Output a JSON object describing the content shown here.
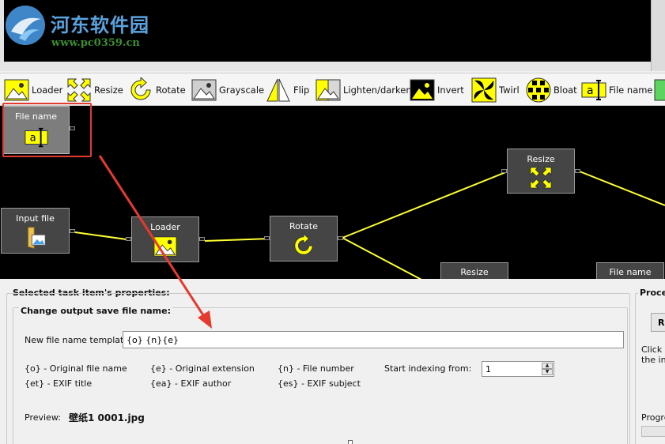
{
  "watermark": {
    "title": "河东软件园",
    "url": "www.pc0359.cn"
  },
  "toolbar": {
    "items": [
      {
        "label": "Loader",
        "icon": "loader-icon"
      },
      {
        "label": "Resize",
        "icon": "resize-icon"
      },
      {
        "label": "Rotate",
        "icon": "rotate-icon"
      },
      {
        "label": "Grayscale",
        "icon": "grayscale-icon"
      },
      {
        "label": "Flip",
        "icon": "flip-icon"
      },
      {
        "label": "Lighten/darken",
        "icon": "lighten-darken-icon"
      },
      {
        "label": "Invert",
        "icon": "invert-icon"
      },
      {
        "label": "Twirl",
        "icon": "twirl-icon"
      },
      {
        "label": "Bloat",
        "icon": "bloat-icon"
      },
      {
        "label": "File name",
        "icon": "file-name-icon"
      }
    ]
  },
  "canvas": {
    "nodes": {
      "file_name": "File name",
      "input_file": "Input file",
      "loader": "Loader",
      "rotate": "Rotate",
      "resize_top": "Resize",
      "resize_bottom": "Resize",
      "file_name_bottom": "File name"
    },
    "wire_color": "#ffff33",
    "highlight_color": "#e53a2e"
  },
  "properties": {
    "section_title": "Selected task item's properties:",
    "group_title": "Change output save file name:",
    "template_label": "New file name template:",
    "template_value": "{o} {n}{e}",
    "legend": {
      "original_name": "{o} - Original file name",
      "original_ext": "{e} - Original extension",
      "file_number": "{n} - File number",
      "exif_title": "{et} - EXIF title",
      "exif_author": "{ea} - EXIF author",
      "exif_subject": "{es} - EXIF subject"
    },
    "start_index_label": "Start indexing from:",
    "start_index_value": "1",
    "preview_label": "Preview:",
    "preview_value": "壁纸1 0001.jpg"
  },
  "process_panel": {
    "title": "Proces",
    "button_label": "R",
    "hint_line1": "Click 'F",
    "hint_line2": "the inp",
    "progress_label": "Progre"
  }
}
